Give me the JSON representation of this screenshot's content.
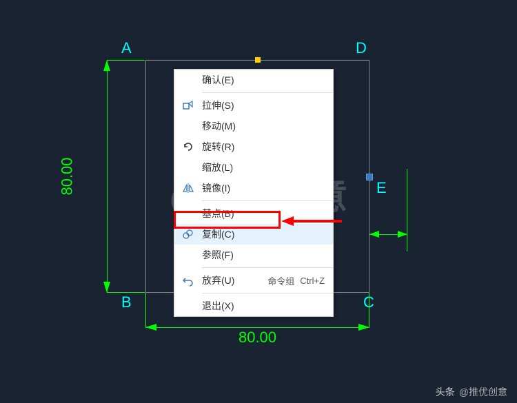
{
  "vertices": {
    "A": "A",
    "B": "B",
    "C": "C",
    "D": "D",
    "E": "E"
  },
  "dimensions": {
    "vertical": "80.00",
    "horizontal": "80.00"
  },
  "menu": {
    "confirm": "确认(E)",
    "stretch": "拉伸(S)",
    "move": "移动(M)",
    "rotate": "旋转(R)",
    "scale": "缩放(L)",
    "mirror": "镜像(I)",
    "basepoint": "基点(B)",
    "copy": "复制(C)",
    "reference": "参照(F)",
    "undo": "放弃(U)",
    "undo_extra": "命令组",
    "undo_shortcut": "Ctrl+Z",
    "exit": "退出(X)"
  },
  "watermark": "@推优创意",
  "footer": {
    "source": "头条",
    "author": "@推优创意"
  },
  "colors": {
    "dim": "#00ff00",
    "label": "#00ffff",
    "highlight": "#ff0000",
    "bg": "#1a2332"
  }
}
